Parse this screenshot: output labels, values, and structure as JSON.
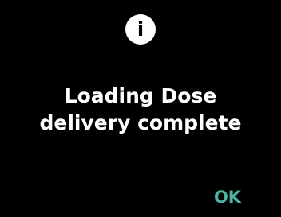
{
  "dialog": {
    "icon": "info-icon",
    "icon_glyph": "i",
    "message_line1": "Loading Dose",
    "message_line2": "delivery complete",
    "ok_label": "OK"
  },
  "colors": {
    "background": "#000000",
    "text": "#ffffff",
    "accent": "#4fb3a2"
  }
}
